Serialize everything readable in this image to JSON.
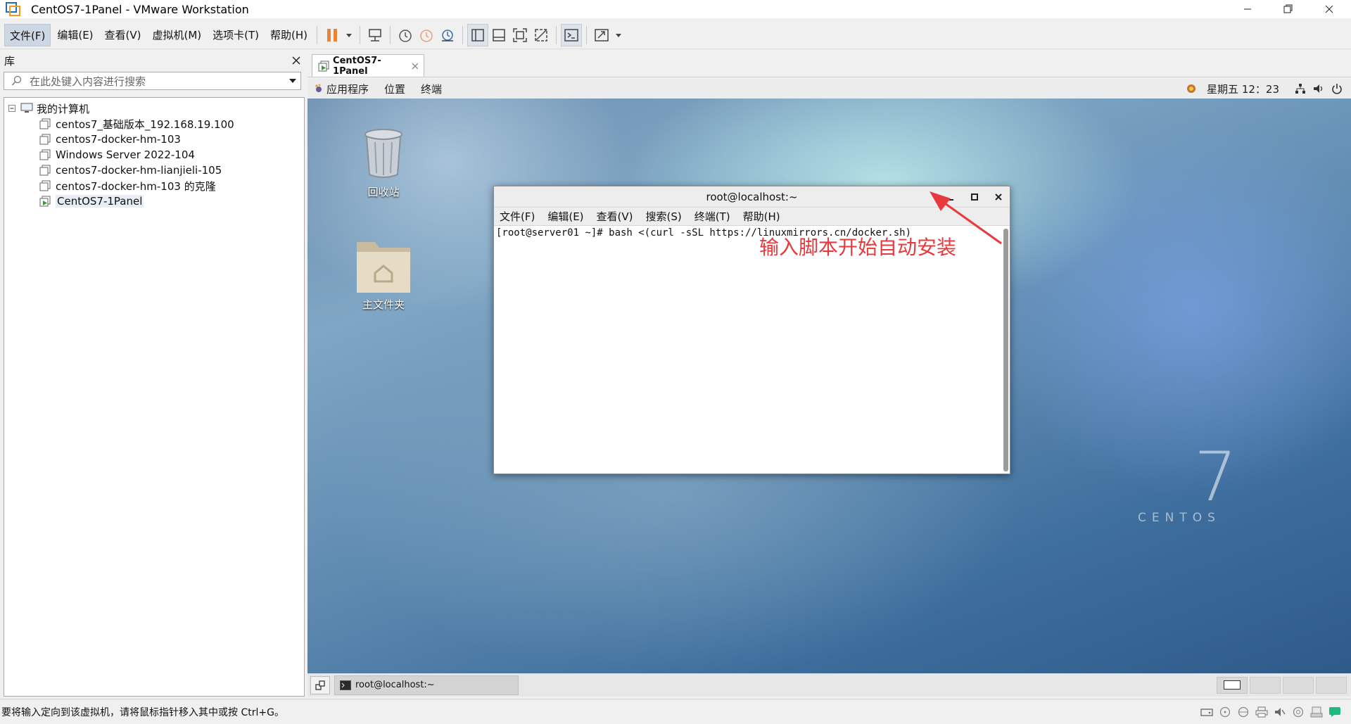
{
  "window": {
    "title": "CentOS7-1Panel - VMware Workstation"
  },
  "menubar": {
    "items": [
      "文件(F)",
      "编辑(E)",
      "查看(V)",
      "虚拟机(M)",
      "选项卡(T)",
      "帮助(H)"
    ]
  },
  "library": {
    "title": "库",
    "search_placeholder": "在此处键入内容进行搜索",
    "root": "我的计算机",
    "vms": [
      "centos7_基础版本_192.168.19.100",
      "centos7-docker-hm-103",
      "Windows Server 2022-104",
      "centos7-docker-hm-lianjieli-105",
      "centos7-docker-hm-103 的克隆",
      "CentOS7-1Panel"
    ]
  },
  "vm_tab": {
    "label": "CentOS7-1Panel"
  },
  "gnome": {
    "apps": "应用程序",
    "places": "位置",
    "terminal": "终端",
    "clock": "星期五 12：23"
  },
  "desktop": {
    "trash_label": "回收站",
    "home_label": "主文件夹",
    "brand_number": "7",
    "brand_text": "CENTOS"
  },
  "terminal": {
    "title": "root@localhost:~",
    "menu": [
      "文件(F)",
      "编辑(E)",
      "查看(V)",
      "搜索(S)",
      "终端(T)",
      "帮助(H)"
    ],
    "command_line": "[root@server01 ~]# bash <(curl -sSL https://linuxmirrors.cn/docker.sh)"
  },
  "annotation": {
    "text": "输入脚本开始自动安装",
    "color": "#e8393c"
  },
  "taskbar": {
    "task_label": "root@localhost:~"
  },
  "statusbar": {
    "hint": "要将输入定向到该虚拟机，请将鼠标指针移入其中或按 Ctrl+G。"
  },
  "colors": {
    "accent": "#e8393c",
    "pause": "#e8833a"
  }
}
